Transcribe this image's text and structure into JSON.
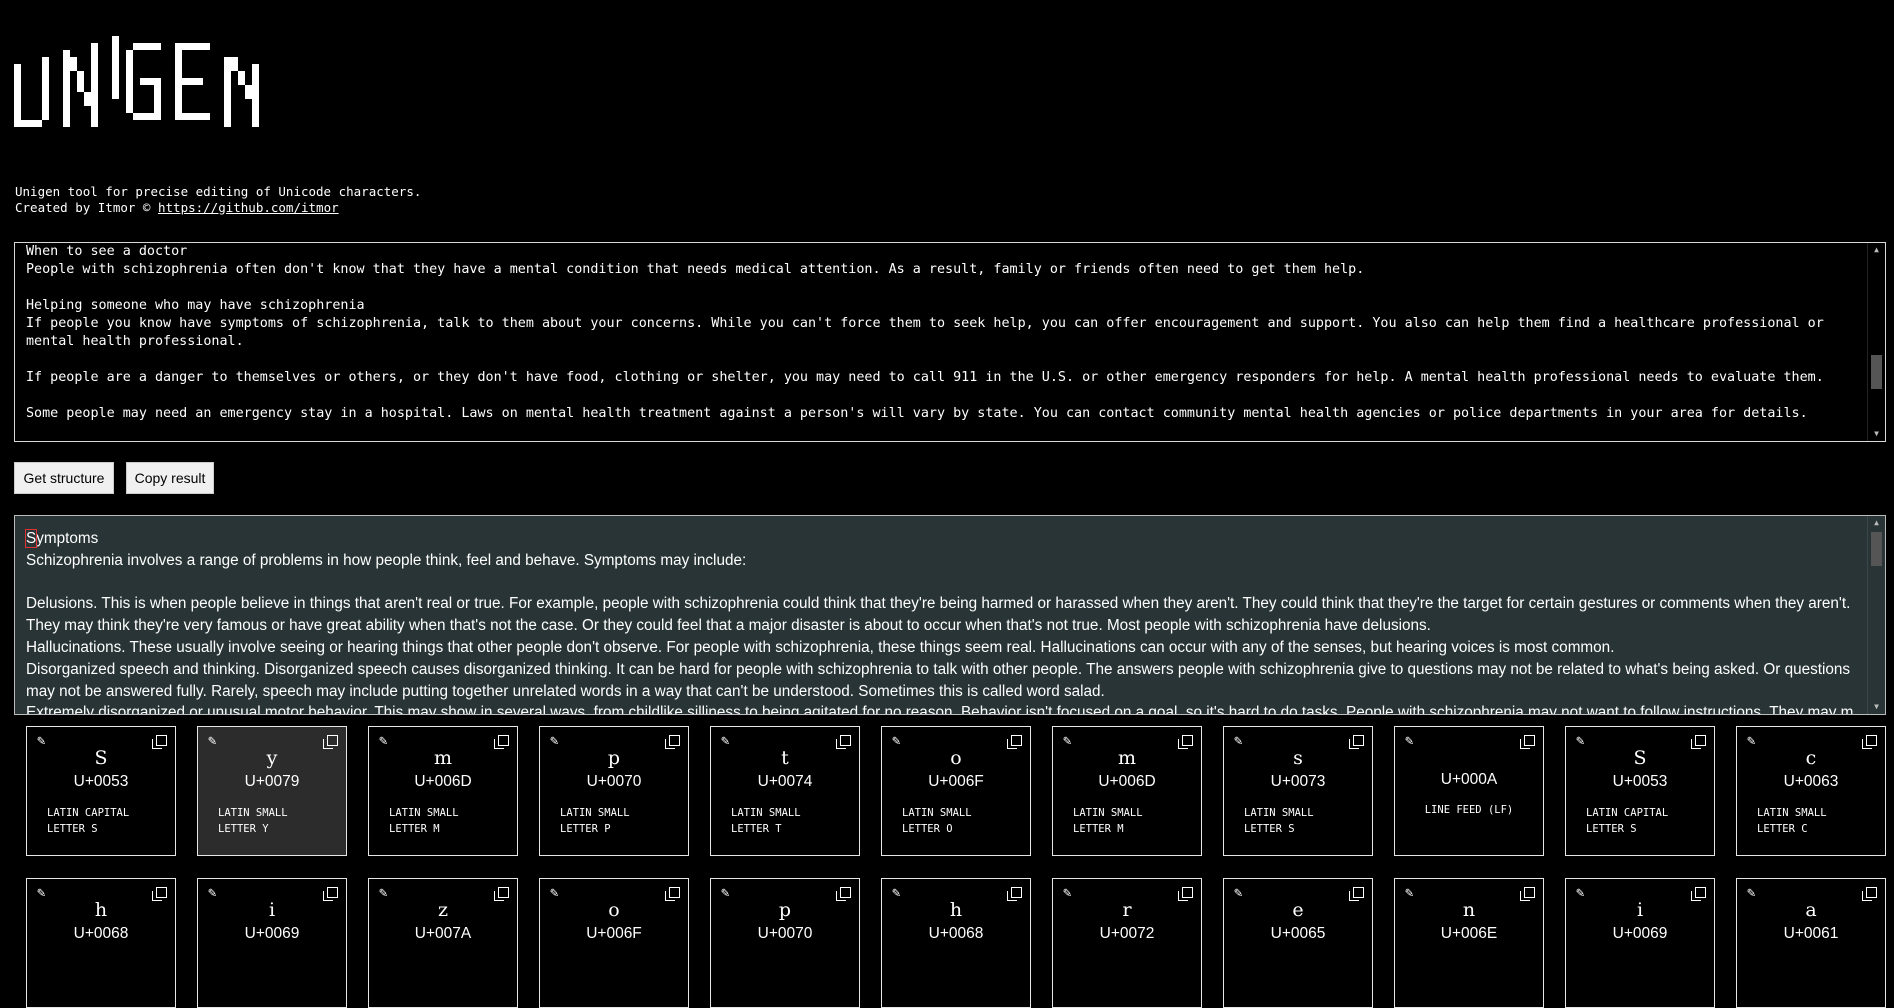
{
  "app": {
    "logo_text": "UNIGEN",
    "intro_line1": "Unigen tool for precise editing of Unicode characters.",
    "intro_line2_prefix": "Created by Itmor © ",
    "intro_link": "https://github.com/itmor"
  },
  "input": {
    "text": "When to see a doctor\nPeople with schizophrenia often don't know that they have a mental condition that needs medical attention. As a result, family or friends often need to get them help.\n\nHelping someone who may have schizophrenia\nIf people you know have symptoms of schizophrenia, talk to them about your concerns. While you can't force them to seek help, you can offer encouragement and support. You also can help them find a healthcare professional or mental health professional.\n\nIf people are a danger to themselves or others, or they don't have food, clothing or shelter, you may need to call 911 in the U.S. or other emergency responders for help. A mental health professional needs to evaluate them.\n\nSome people may need an emergency stay in a hospital. Laws on mental health treatment against a person's will vary by state. You can contact community mental health agencies or police departments in your area for details."
  },
  "buttons": {
    "get_structure": "Get structure",
    "copy_result": "Copy result"
  },
  "result": {
    "first_char": "S",
    "first_rest": "ymptoms",
    "text": "\nSchizophrenia involves a range of problems in how people think, feel and behave. Symptoms may include:\n\nDelusions. This is when people believe in things that aren't real or true. For example, people with schizophrenia could think that they're being harmed or harassed when they aren't. They could think that they're the target for certain gestures or comments when they aren't. They may think they're very famous or have great ability when that's not the case. Or they could feel that a major disaster is about to occur when that's not true. Most people with schizophrenia have delusions.\nHallucinations. These usually involve seeing or hearing things that other people don't observe. For people with schizophrenia, these things seem real. Hallucinations can occur with any of the senses, but hearing voices is most common.\nDisorganized speech and thinking. Disorganized speech causes disorganized thinking. It can be hard for people with schizophrenia to talk with other people. The answers people with schizophrenia give to questions may not be related to what's being asked. Or questions may not be answered fully. Rarely, speech may include putting together unrelated words in a way that can't be understood. Sometimes this is called word salad.\nExtremely disorganized or unusual motor behavior. This may show in several ways, from childlike silliness to being agitated for no reason. Behavior isn't focused on a goal, so it's hard to do tasks. People with schizophrenia may not want to follow instructions. They may move in ways that are not appropriate."
  },
  "cards_row1": [
    {
      "glyph": "S",
      "code": "U+0053",
      "name1": "LATIN CAPITAL",
      "name2": "LETTER S"
    },
    {
      "glyph": "y",
      "code": "U+0079",
      "name1": "LATIN SMALL",
      "name2": "LETTER Y"
    },
    {
      "glyph": "m",
      "code": "U+006D",
      "name1": "LATIN SMALL",
      "name2": "LETTER M"
    },
    {
      "glyph": "p",
      "code": "U+0070",
      "name1": "LATIN SMALL",
      "name2": "LETTER P"
    },
    {
      "glyph": "t",
      "code": "U+0074",
      "name1": "LATIN SMALL",
      "name2": "LETTER T"
    },
    {
      "glyph": "o",
      "code": "U+006F",
      "name1": "LATIN SMALL",
      "name2": "LETTER O"
    },
    {
      "glyph": "m",
      "code": "U+006D",
      "name1": "LATIN SMALL",
      "name2": "LETTER M"
    },
    {
      "glyph": "s",
      "code": "U+0073",
      "name1": "LATIN SMALL",
      "name2": "LETTER S"
    },
    {
      "glyph": "",
      "code": "U+000A",
      "name1": "LINE FEED (LF)",
      "name2": ""
    },
    {
      "glyph": "S",
      "code": "U+0053",
      "name1": "LATIN CAPITAL",
      "name2": "LETTER S"
    },
    {
      "glyph": "c",
      "code": "U+0063",
      "name1": "LATIN SMALL",
      "name2": "LETTER C"
    }
  ],
  "cards_row2": [
    {
      "glyph": "h",
      "code": "U+0068"
    },
    {
      "glyph": "i",
      "code": "U+0069"
    },
    {
      "glyph": "z",
      "code": "U+007A"
    },
    {
      "glyph": "o",
      "code": "U+006F"
    },
    {
      "glyph": "p",
      "code": "U+0070"
    },
    {
      "glyph": "h",
      "code": "U+0068"
    },
    {
      "glyph": "r",
      "code": "U+0072"
    },
    {
      "glyph": "e",
      "code": "U+0065"
    },
    {
      "glyph": "n",
      "code": "U+006E"
    },
    {
      "glyph": "i",
      "code": "U+0069"
    },
    {
      "glyph": "a",
      "code": "U+0061"
    }
  ],
  "icons": {
    "edit": "pencil-icon",
    "copy": "copy-icon"
  }
}
